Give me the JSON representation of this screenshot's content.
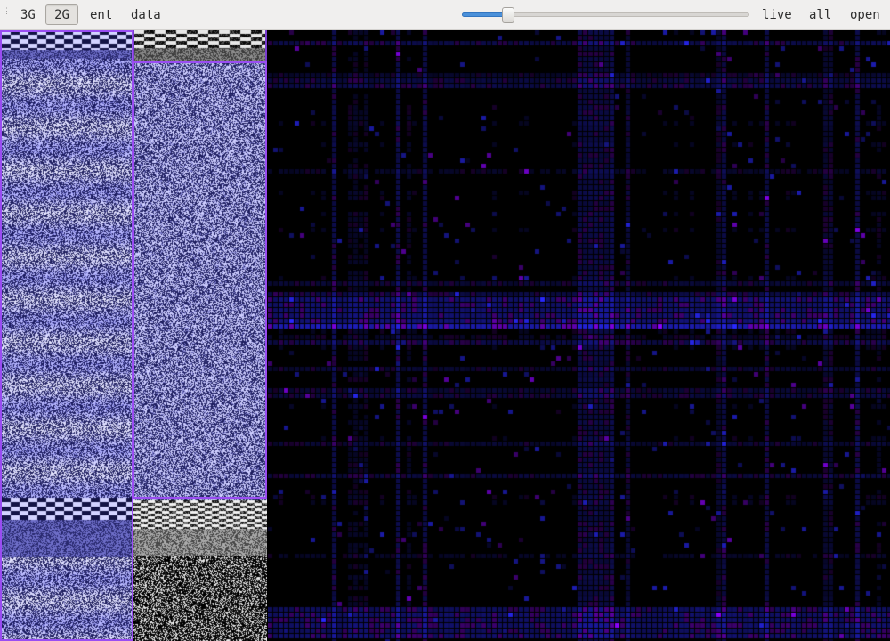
{
  "toolbar": {
    "buttons": {
      "mode_3g": "3G",
      "mode_2g": "2G",
      "entropy": "ent",
      "data": "data",
      "live": "live",
      "all": "all",
      "open": "open"
    },
    "active_button": "mode_2g",
    "slider": {
      "value": 0.14,
      "accent_color": "#4a90d9"
    }
  },
  "colors": {
    "selection_border": "#9a4df2",
    "noise_tint": "#c8c8ff",
    "heatmap_base": "#2d2dff",
    "heatmap_accent": "#8a28ff"
  }
}
